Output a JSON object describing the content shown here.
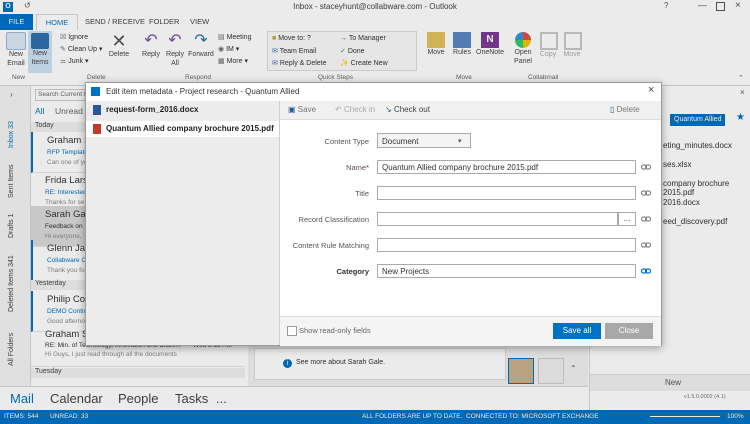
{
  "window": {
    "title": "Inbox - staceyhunt@collabware.com - Outlook"
  },
  "ribbon_tabs": [
    "FILE",
    "HOME",
    "SEND / RECEIVE",
    "FOLDER",
    "VIEW"
  ],
  "ribbon": {
    "new_email": "New\nEmail",
    "new_items": "New\nItems",
    "ignore": "Ignore",
    "clean_up": "Clean Up",
    "junk": "Junk",
    "delete": "Delete",
    "reply": "Reply",
    "reply_all": "Reply\nAll",
    "forward": "Forward",
    "meeting": "Meeting",
    "im": "IM",
    "more": "More",
    "qs_move_to": "Move to: ?",
    "qs_team_email": "Team Email",
    "qs_reply_delete": "Reply & Delete",
    "qs_to_manager": "To Manager",
    "qs_done": "Done",
    "qs_create_new": "Create New",
    "move": "Move",
    "rules": "Rules",
    "onenote": "OneNote",
    "open_panel": "Open\nPanel",
    "copy": "Copy",
    "move2": "Move",
    "groups": {
      "new": "New",
      "delete": "Delete",
      "respond": "Respond",
      "quick_steps": "Quick Steps",
      "collabmail": "Collabmail"
    }
  },
  "left_folders": [
    "Inbox 33",
    "Sent Items",
    "Drafts 1",
    "Deleted Items 341",
    "All Folders"
  ],
  "search": {
    "placeholder": "Search Current Mailbox"
  },
  "list_filters": {
    "all": "All",
    "unread": "Unread"
  },
  "mail_groups": {
    "today": "Today",
    "yesterday": "Yesterday",
    "tuesday": "Tuesday"
  },
  "mail_items": [
    {
      "name": "Graham Sib",
      "subject": "RFP Template",
      "preview": "Can one of yo"
    },
    {
      "name": "Frida Larsen",
      "subject": "RE: Interested",
      "preview": "Thanks for se"
    },
    {
      "name": "Sarah Gale",
      "subject": "Feedback on",
      "preview": "Hi everyone,"
    },
    {
      "name": "Glenn James",
      "subject": "Collabware CL",
      "preview": "Thank you for"
    },
    {
      "name": "Philip Coop",
      "subject": "DEMO Continu",
      "preview": "Good afternoo"
    },
    {
      "name": "Graham Sib",
      "subject": "RE: Min. of Technology, Innovation and Citize...",
      "preview": "Hi Guys, I just read through all the documents",
      "date": "Wed 8:12 AM"
    }
  ],
  "people": {
    "see_more": "See more about Sarah Gale."
  },
  "right_pane": {
    "crumb": "Quantum Allied",
    "files": [
      "eting_minutes.docx",
      "ses.xlsx",
      "company brochure 2015.pdf",
      "2016.docx",
      "eed_discovery.pdf"
    ],
    "new_label": "New",
    "version": "v1.5.0.0002 (4.1)"
  },
  "bottom_nav": [
    "Mail",
    "Calendar",
    "People",
    "Tasks",
    "..."
  ],
  "status": {
    "items": "ITEMS: 544",
    "unread": "UNREAD: 33",
    "folders": "ALL FOLDERS ARE UP TO DATE.",
    "connected": "CONNECTED TO: MICROSOFT EXCHANGE",
    "zoom": "100%"
  },
  "dialog": {
    "title": "Edit item metadata - Project research - Quantum Allied",
    "files": [
      "request-form_2016.docx",
      "Quantum Allied company brochure 2015.pdf"
    ],
    "toolbar": {
      "save": "Save",
      "check_in": "Check in",
      "check_out": "Check out",
      "delete": "Delete"
    },
    "fields": {
      "content_type_label": "Content Type",
      "content_type_value": "Document",
      "name_label": "Name",
      "name_value": "Quantum Allied company brochure 2015.pdf",
      "title_label": "Title",
      "title_value": "",
      "record_label": "Record Classification",
      "record_value": "",
      "browse": "...",
      "rule_label": "Content Rule Matching",
      "rule_value": "",
      "category_label": "Category",
      "category_value": "New Projects",
      "required_mark": "*"
    },
    "show_readonly": "Show read-only fields",
    "save_all": "Save all",
    "close": "Close"
  },
  "colors": {
    "accent": "#0072c6",
    "status_bar": "#0072c6"
  }
}
